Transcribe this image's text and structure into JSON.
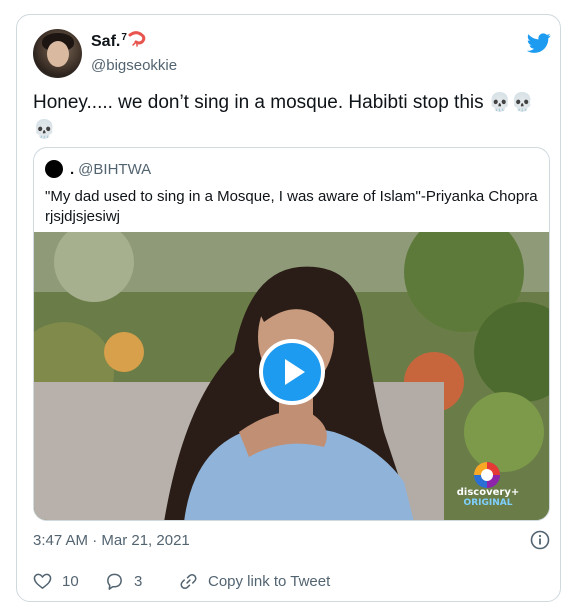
{
  "author": {
    "display_name": "Saf.",
    "name_superscript": "7",
    "handle": "@bigseokkie"
  },
  "tweet": {
    "text": "Honey..... we don’t sing in a mosque. Habibti stop this",
    "emoji": "💀💀💀"
  },
  "quote": {
    "user_name": ".",
    "user_handle": "@BIHTWA",
    "text": "\"My dad used to sing in a Mosque, I was aware of Islam\"-Priyanka Chopra  rjsjdjsjesiwj"
  },
  "video": {
    "brand_line1": "discovery+",
    "brand_line2": "ORIGINAL"
  },
  "meta": {
    "timestamp": "3:47 AM · Mar 21, 2021"
  },
  "actions": {
    "likes": "10",
    "replies": "3",
    "copy_link": "Copy link to Tweet"
  },
  "colors": {
    "twitter_blue": "#1d9bf0",
    "secondary_text": "#536471",
    "primary_text": "#0f1419",
    "border": "#cfd9de"
  }
}
